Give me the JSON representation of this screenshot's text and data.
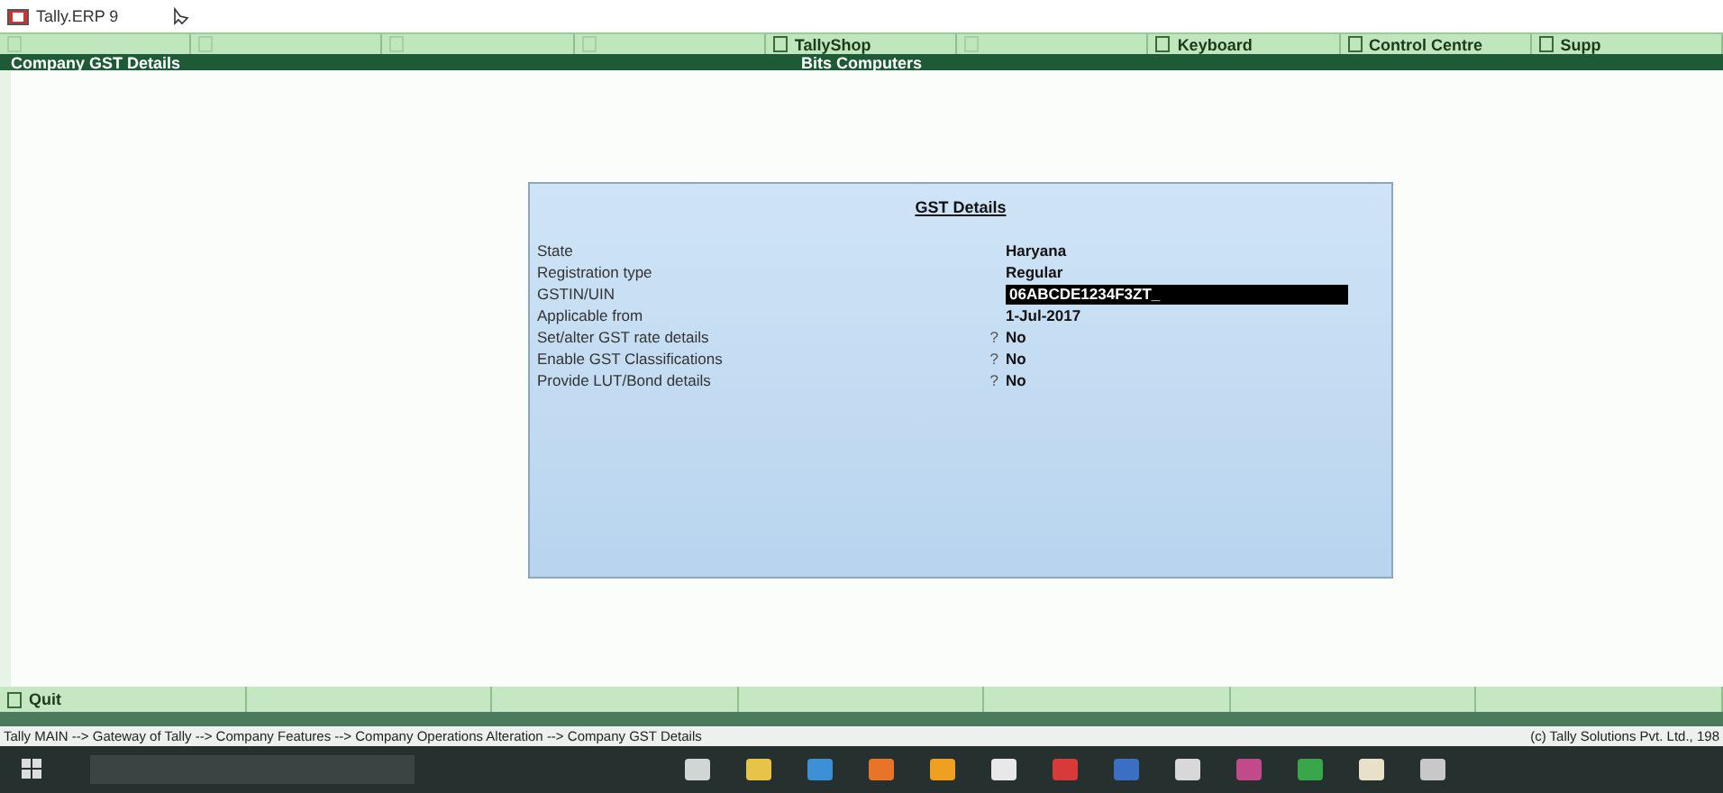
{
  "window": {
    "title": "Tally.ERP 9"
  },
  "toolbar": [
    {
      "disabled": true
    },
    {
      "disabled": true
    },
    {
      "disabled": true
    },
    {
      "disabled": true
    },
    {
      "label": "TallyShop",
      "disabled": false
    },
    {
      "disabled": true
    },
    {
      "label": "Keyboard",
      "disabled": false
    },
    {
      "label": "Control Centre",
      "disabled": false
    },
    {
      "label": "Supp",
      "disabled": false
    }
  ],
  "header": {
    "title": "Company GST Details",
    "company": "Bits Computers"
  },
  "dialog": {
    "title": "GST Details",
    "rows": [
      {
        "kind": "text",
        "label": "State",
        "value": "Haryana"
      },
      {
        "kind": "text",
        "label": "Registration type",
        "value": "Regular"
      },
      {
        "kind": "input",
        "label": "GSTIN/UIN",
        "value": "06ABCDE1234F3ZT_"
      },
      {
        "kind": "text",
        "label": "Applicable from",
        "value": "1-Jul-2017"
      },
      {
        "kind": "choice",
        "label": "Set/alter GST rate details",
        "prompt": "?",
        "value": "No"
      },
      {
        "kind": "choice",
        "label": "Enable GST Classifications",
        "prompt": "?",
        "value": "No"
      },
      {
        "kind": "choice",
        "label": "Provide LUT/Bond details",
        "prompt": "?",
        "value": "No"
      }
    ]
  },
  "bottom_buttons": [
    {
      "kind": "key",
      "label": "Quit"
    },
    {
      "kind": "blank"
    },
    {
      "kind": "blank"
    },
    {
      "kind": "blank"
    },
    {
      "kind": "blank"
    },
    {
      "kind": "blank"
    },
    {
      "kind": "blank"
    }
  ],
  "status_bar": {
    "path": "Tally MAIN --> Gateway of Tally --> Company Features --> Company Operations  Alteration --> Company GST Details",
    "copyright": "(c) Tally Solutions Pvt. Ltd., 198"
  }
}
